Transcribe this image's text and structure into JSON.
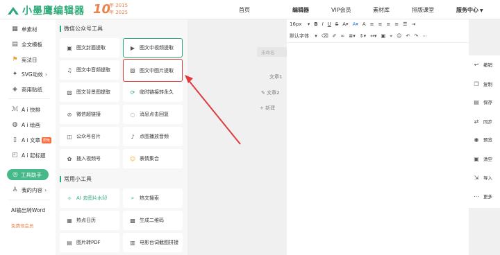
{
  "app": {
    "logo_text": "小墨鹰编辑器",
    "anniversary": "10",
    "anniversary_dates": [
      "年 2015",
      "年 2025"
    ],
    "brand_color": "#2aa876"
  },
  "nav": [
    {
      "label": "首页"
    },
    {
      "label": "编辑器"
    },
    {
      "label": "VIP会员"
    },
    {
      "label": "素材库"
    },
    {
      "label": "排版课堂"
    },
    {
      "label": "服务中心"
    }
  ],
  "sidebar": {
    "items": [
      {
        "label": "单素材",
        "icon": "grid-icon"
      },
      {
        "label": "全文模板",
        "icon": "layout-icon"
      },
      {
        "label": "宪法日",
        "icon": "flag-icon"
      },
      {
        "label": "SVG动效",
        "icon": "svg-icon"
      },
      {
        "label": "商用贴纸",
        "icon": "sticker-icon"
      },
      {
        "label": "A i 快排",
        "icon": "ai-icon"
      },
      {
        "label": "A i 绘画",
        "icon": "palette-icon"
      },
      {
        "label": "A i 文章",
        "icon": "doc-icon",
        "badge": "限免"
      },
      {
        "label": "A i 起标题",
        "icon": "title-icon"
      },
      {
        "label": "工具助手",
        "icon": "tools-icon"
      },
      {
        "label": "我的内容",
        "icon": "user-icon"
      }
    ],
    "word_export": "AI输出转Word",
    "free_trial": "免费领会员"
  },
  "tools": {
    "section1": "微信公众号工具",
    "section2": "常用小工具",
    "wechat_tools": [
      {
        "label": "图文封面提取",
        "icon": "image-icon"
      },
      {
        "label": "图文中视频提取",
        "icon": "video-icon"
      },
      {
        "label": "图文中音频提取",
        "icon": "music-icon"
      },
      {
        "label": "图文中图片提取",
        "icon": "picture-icon"
      },
      {
        "label": "图文背景图提取",
        "icon": "bg-image-icon"
      },
      {
        "label": "临时链接转永久",
        "icon": "link-icon"
      },
      {
        "label": "微信超链接",
        "icon": "chain-icon"
      },
      {
        "label": "消息点击回复",
        "icon": "chat-icon"
      },
      {
        "label": "公众号名片",
        "icon": "card-icon"
      },
      {
        "label": "点图播放音频",
        "icon": "audio-icon"
      },
      {
        "label": "插入视频号",
        "icon": "channel-icon"
      },
      {
        "label": "表情集合",
        "icon": "emoji-icon"
      }
    ],
    "common_tools": [
      {
        "label": "AI 去图片水印",
        "icon": "ai-eraser-icon"
      },
      {
        "label": "热文搜索",
        "icon": "search-icon"
      },
      {
        "label": "热点日历",
        "icon": "calendar-icon"
      },
      {
        "label": "生成二维码",
        "icon": "qrcode-icon"
      },
      {
        "label": "图片转PDF",
        "icon": "pdf-icon"
      },
      {
        "label": "电影台词截图拼接",
        "icon": "film-icon"
      }
    ]
  },
  "editor": {
    "doc_tag": "未命名",
    "articles": [
      "文章1",
      "文章2"
    ],
    "add_new": "新建",
    "toolbar_font_size": "16px",
    "toolbar_font_family": "默认字体"
  },
  "actions": [
    {
      "label": "撤销",
      "icon": "undo-icon"
    },
    {
      "label": "复制",
      "icon": "copy-icon"
    },
    {
      "label": "保存",
      "icon": "save-icon"
    },
    {
      "label": "同步",
      "icon": "sync-icon"
    },
    {
      "label": "预览",
      "icon": "eye-icon"
    },
    {
      "label": "清空",
      "icon": "trash-icon"
    },
    {
      "label": "导入",
      "icon": "import-icon"
    },
    {
      "label": "更多",
      "icon": "more-icon"
    }
  ]
}
